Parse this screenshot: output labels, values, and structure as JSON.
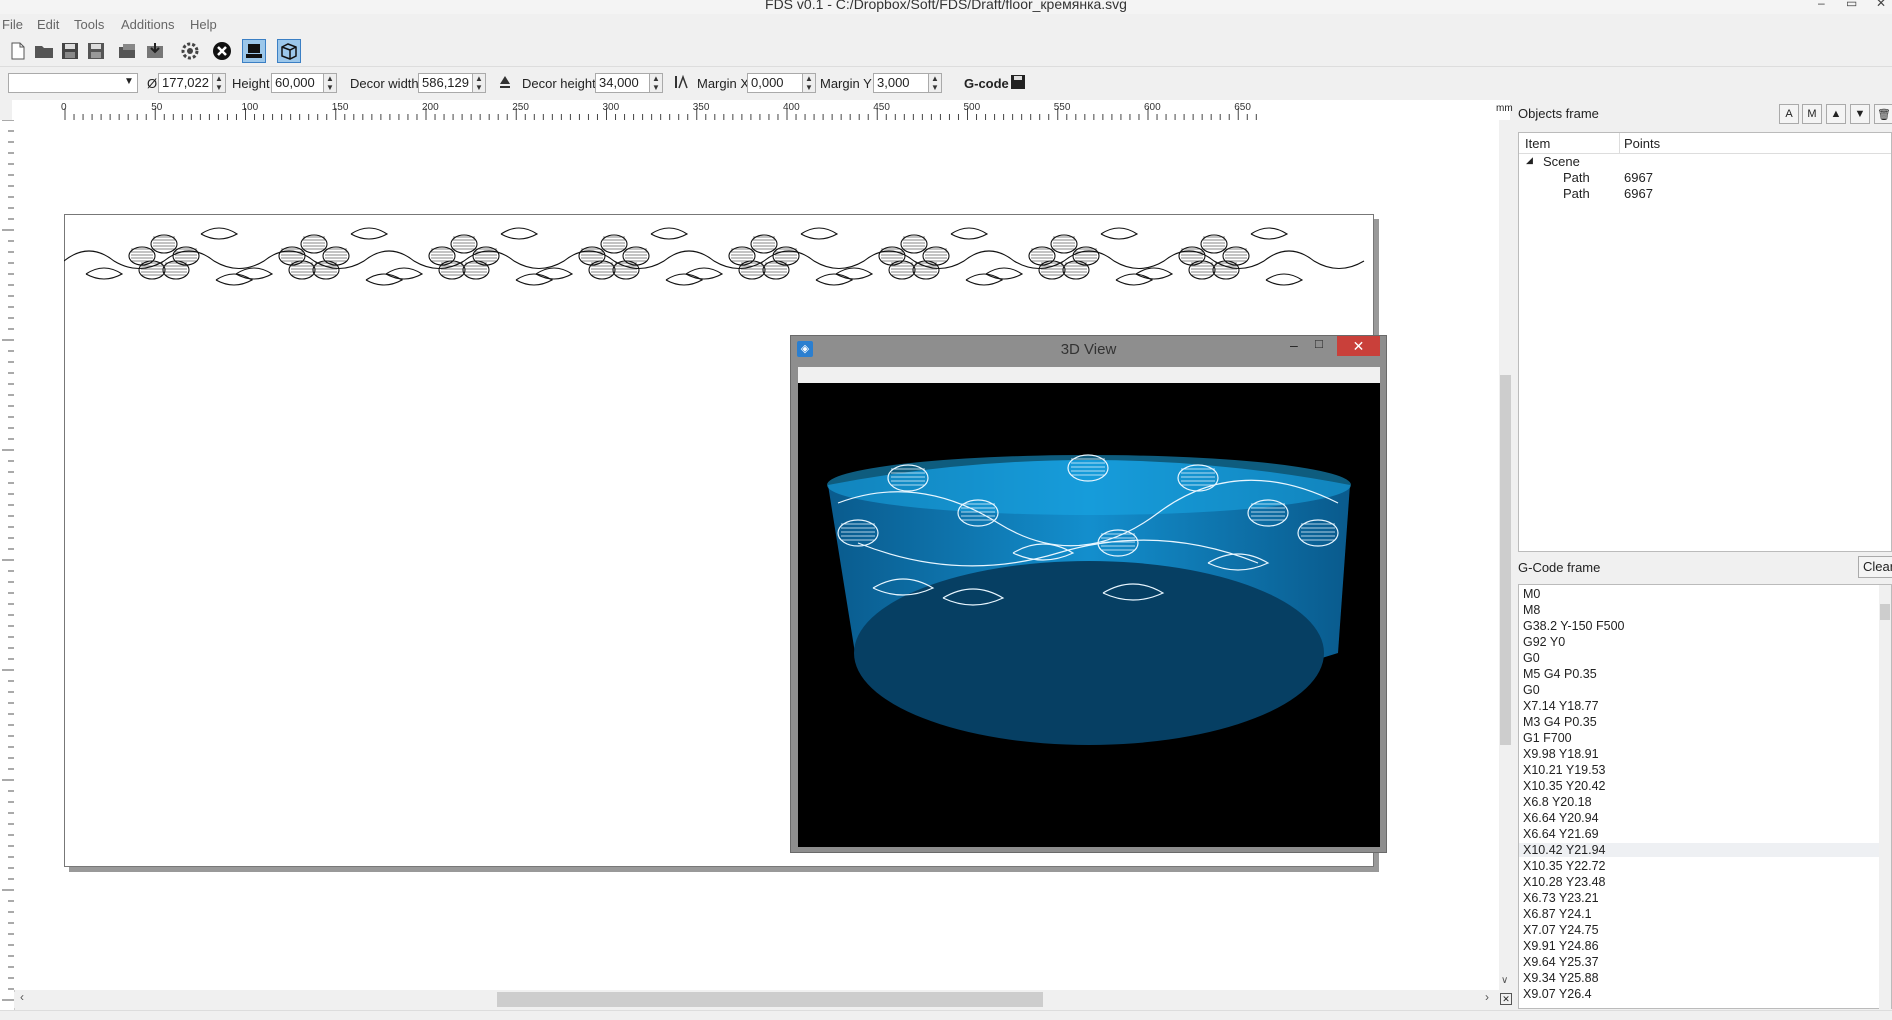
{
  "window": {
    "title": "FDS v0.1 - C:/Dropbox/Soft/FDS/Draft/floor_кремянка.svg",
    "minimize": "–",
    "maximize": "▭",
    "close": "✕"
  },
  "menu": [
    "File",
    "Edit",
    "Tools",
    "Additions",
    "Help"
  ],
  "params": {
    "profile_select": "",
    "diameter_symbol": "Ø",
    "diameter": "177,022",
    "height_label": "Height",
    "height": "60,000",
    "decor_width_label": "Decor width",
    "decor_width": "586,129",
    "decor_height_label": "Decor height",
    "decor_height": "34,000",
    "margin_x_label": "Margin X",
    "margin_x": "0,000",
    "margin_y_label": "Margin Y",
    "margin_y": "3,000",
    "gcode_label": "G-code"
  },
  "ruler": {
    "ticks": [
      "0",
      "50",
      "100",
      "150",
      "200",
      "250",
      "300",
      "350",
      "400",
      "450",
      "500",
      "550",
      "600",
      "650"
    ],
    "unit": "mm"
  },
  "objects_frame": {
    "title": "Objects frame",
    "buttons": [
      "A",
      "M",
      "▲",
      "▼",
      "🗑"
    ],
    "columns": [
      "Item",
      "Points"
    ],
    "root": "Scene",
    "items": [
      {
        "item": "Path",
        "points": "6967"
      },
      {
        "item": "Path",
        "points": "6967"
      }
    ]
  },
  "gcode_frame": {
    "title": "G-Code frame",
    "clear_label": "Clear",
    "lines": [
      "M0",
      "M8",
      "G38.2 Y-150 F500",
      "G92 Y0",
      "G0",
      "M5 G4 P0.35",
      "G0",
      "X7.14 Y18.77",
      "M3 G4 P0.35",
      "G1 F700",
      "X9.98 Y18.91",
      "X10.21 Y19.53",
      "X10.35 Y20.42",
      "X6.8 Y20.18",
      "X6.64 Y20.94",
      "X6.64 Y21.69",
      "X10.42 Y21.94",
      "X10.35 Y22.72",
      "X10.28 Y23.48",
      "X6.73 Y23.21",
      "X6.87 Y24.1",
      "X7.07 Y24.75",
      "X9.91 Y24.86",
      "X9.64 Y25.37",
      "X9.34 Y25.88",
      "X9.07 Y26.4"
    ],
    "selected_index": 16
  },
  "view3d": {
    "title": "3D View",
    "minimize": "–",
    "maximize": "□",
    "close": "✕"
  },
  "colors": {
    "accent": "#3b7fc4",
    "bowl": "#0d7fc0",
    "bowl_dark": "#074a72",
    "close_red": "#c9403a"
  }
}
